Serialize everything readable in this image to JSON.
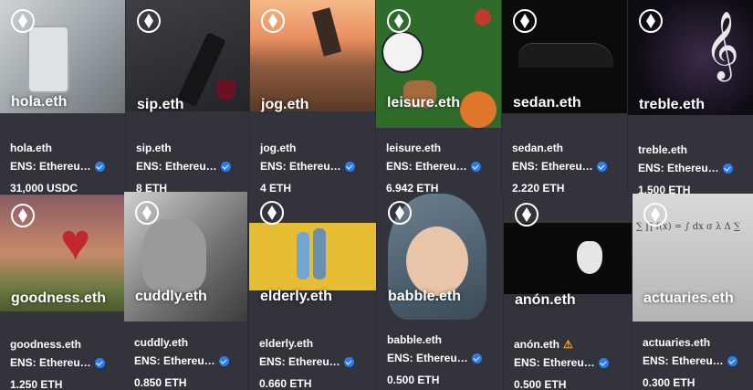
{
  "cards": [
    {
      "image_label": "hola.eth",
      "title": "hola.eth",
      "collection": "ENS: Ethereu…",
      "price": "31,000 USDC"
    },
    {
      "image_label": "sip.eth",
      "title": "sip.eth",
      "collection": "ENS: Ethereu…",
      "price": "8 ETH"
    },
    {
      "image_label": "jog.eth",
      "title": "jog.eth",
      "collection": "ENS: Ethereu…",
      "price": "4 ETH"
    },
    {
      "image_label": "leisure.eth",
      "title": "leisure.eth",
      "collection": "ENS: Ethereu…",
      "price": "6.942 ETH"
    },
    {
      "image_label": "sedan.eth",
      "title": "sedan.eth",
      "collection": "ENS: Ethereu…",
      "price": "2.220 ETH"
    },
    {
      "image_label": "treble.eth",
      "title": "treble.eth",
      "collection": "ENS: Ethereu…",
      "price": "1.500 ETH"
    },
    {
      "image_label": "goodness.eth",
      "title": "goodness.eth",
      "collection": "ENS: Ethereu…",
      "price": "1.250 ETH"
    },
    {
      "image_label": "cuddly.eth",
      "title": "cuddly.eth",
      "collection": "ENS: Ethereu…",
      "price": "0.850 ETH"
    },
    {
      "image_label": "elderly.eth",
      "title": "elderly.eth",
      "collection": "ENS: Ethereu…",
      "price": "0.660 ETH"
    },
    {
      "image_label": "babble.eth",
      "title": "babble.eth",
      "collection": "ENS: Ethereu…",
      "price": "0.500 ETH"
    },
    {
      "image_label": "anón.eth",
      "title": "anón.eth",
      "collection": "ENS: Ethereu…",
      "price": "0.500 ETH"
    },
    {
      "image_label": "actuaries.eth",
      "title": "actuaries.eth",
      "collection": "ENS: Ethereu…",
      "price": "0.300 ETH"
    }
  ],
  "colors": {
    "verified": "#2a7ef2",
    "warning": "#f5a623",
    "card_bg": "#33343b",
    "page_bg": "#2a2b31"
  },
  "icons": {
    "logo": "ens-logo-icon",
    "verified": "verified-badge-icon",
    "warning": "warning-icon"
  }
}
